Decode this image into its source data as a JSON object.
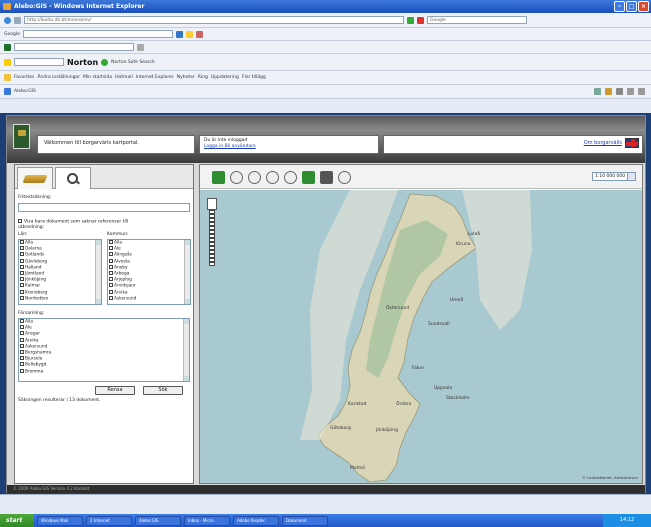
{
  "window": {
    "title": "Alebo:GIS - Windows Internet Explorer"
  },
  "browser": {
    "address": "http://ikultu.dk.bt/innova/ov/",
    "search_engine": "Google",
    "norton_label": "Norton",
    "protection_label": "Norton Safe Search",
    "favorites": [
      "Favorites",
      "Ändra inställningar",
      "Min startsida",
      "Hotmail",
      "Internet Explorer",
      "Nyheter",
      "Ring",
      "Uppdatering",
      "Fler tillägg"
    ],
    "tab_title": "Alebo:GIS"
  },
  "header": {
    "welcome_text": "Välkommen till borgarvärls kartportal.",
    "login_text": "Du är inte inloggad",
    "login_links": "Logga in   Bli användare",
    "language_link": "Om borgarvälls"
  },
  "left_panel": {
    "field_label": "Fritextsökning:",
    "checkbox_label": "Visa bara dokument som saknar referenser till",
    "scope_label": "utbredning:",
    "lan_label": "Län:",
    "kommun_label": "Kommun:",
    "lan_items": [
      "Alla",
      "Dalarna",
      "Gotlands",
      "Gävleborg",
      "Halland",
      "Jämtland",
      "Jönköping",
      "Kalmar",
      "Kronoberg",
      "Norrbotten"
    ],
    "kommun_items": [
      "Alla",
      "Ale",
      "Alingsås",
      "Alvesta",
      "Aneby",
      "Arboga",
      "Arjeplog",
      "Arvidsjaur",
      "Arvika",
      "Askersund"
    ],
    "forsamling_label": "Församling:",
    "forsamling_items": [
      "Alla",
      "Ale",
      "Ansgar",
      "Arvika",
      "Askersund",
      "Bergshamra",
      "Bjursele",
      "Bollebygd",
      "Bromma"
    ],
    "reset_label": "Rensa",
    "search_label": "Sök",
    "result_text": "Sökningen resulterar i 13 dokument."
  },
  "map": {
    "scale_value": "1:10 000 000",
    "cities": [
      {
        "name": "Kiruna"
      },
      {
        "name": "Luleå"
      },
      {
        "name": "Umeå"
      },
      {
        "name": "Östersund"
      },
      {
        "name": "Sundsvall"
      },
      {
        "name": "Falun"
      },
      {
        "name": "Uppsala"
      },
      {
        "name": "Stockholm"
      },
      {
        "name": "Karlstad"
      },
      {
        "name": "Örebro"
      },
      {
        "name": "Göteborg"
      },
      {
        "name": "Jönköping"
      },
      {
        "name": "Malmö"
      }
    ],
    "copyright": "© Lantmäteriet, Kartcentrum"
  },
  "footer_text": "© 2009 Alebo:GIS   Version 4.2   Kontakt",
  "taskbar": {
    "start_label": "start",
    "tasks": [
      "Windows Mail",
      "2 Internet",
      "Alebo:GIS",
      "Inbox - Micro",
      "Adobe Reader",
      "Dokument"
    ],
    "clock": "14:12"
  },
  "colors": {
    "map_water": "#a7c9cf",
    "map_land": "#d9d6b8",
    "forest": "#9fc09a",
    "tool_green": "#2e8d2e"
  }
}
